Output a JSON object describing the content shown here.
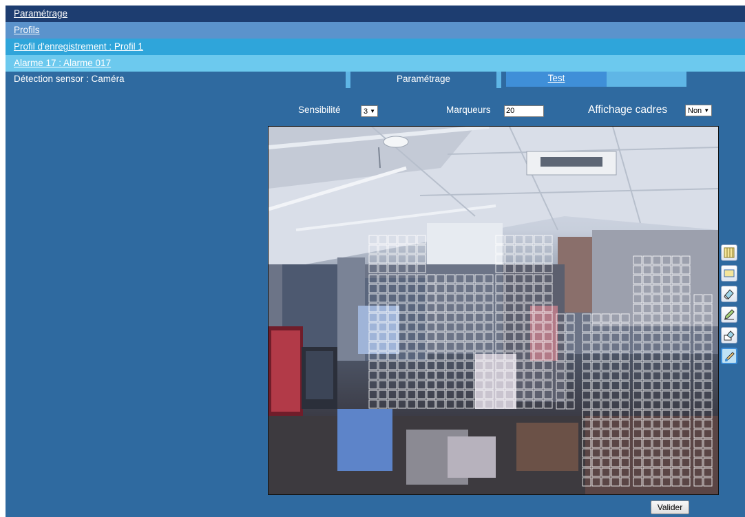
{
  "breadcrumb": {
    "level0": "Paramétrage",
    "level1": "Profils",
    "level2": "Profil d'enregistrement : Profil 1",
    "level3": "Alarme 17 : Alarme 017"
  },
  "sensor": {
    "label": "Détection sensor : Caméra"
  },
  "tabs": {
    "active": "Paramétrage",
    "other": "Test"
  },
  "controls": {
    "sensibilite_label": "Sensibilité",
    "sensibilite_value": "3",
    "marqueurs_label": "Marqueurs",
    "marqueurs_value": "20",
    "affichage_label": "Affichage cadres",
    "affichage_value": "Non"
  },
  "tools": [
    {
      "name": "grid-fill-tool-icon"
    },
    {
      "name": "rectangle-tool-icon"
    },
    {
      "name": "eraser-tool-icon"
    },
    {
      "name": "pencil-tool-icon"
    },
    {
      "name": "eraser-fill-tool-icon"
    },
    {
      "name": "brush-tool-icon",
      "selected": true
    }
  ],
  "buttons": {
    "valider": "Valider"
  },
  "colors": {
    "frame_bg": "#2f6aa0",
    "crumb0": "#1d3d70",
    "crumb1": "#5b93cc",
    "crumb2": "#2fa5da",
    "crumb3": "#6cc9ee",
    "tab_inactive": "#3f8fd8"
  }
}
